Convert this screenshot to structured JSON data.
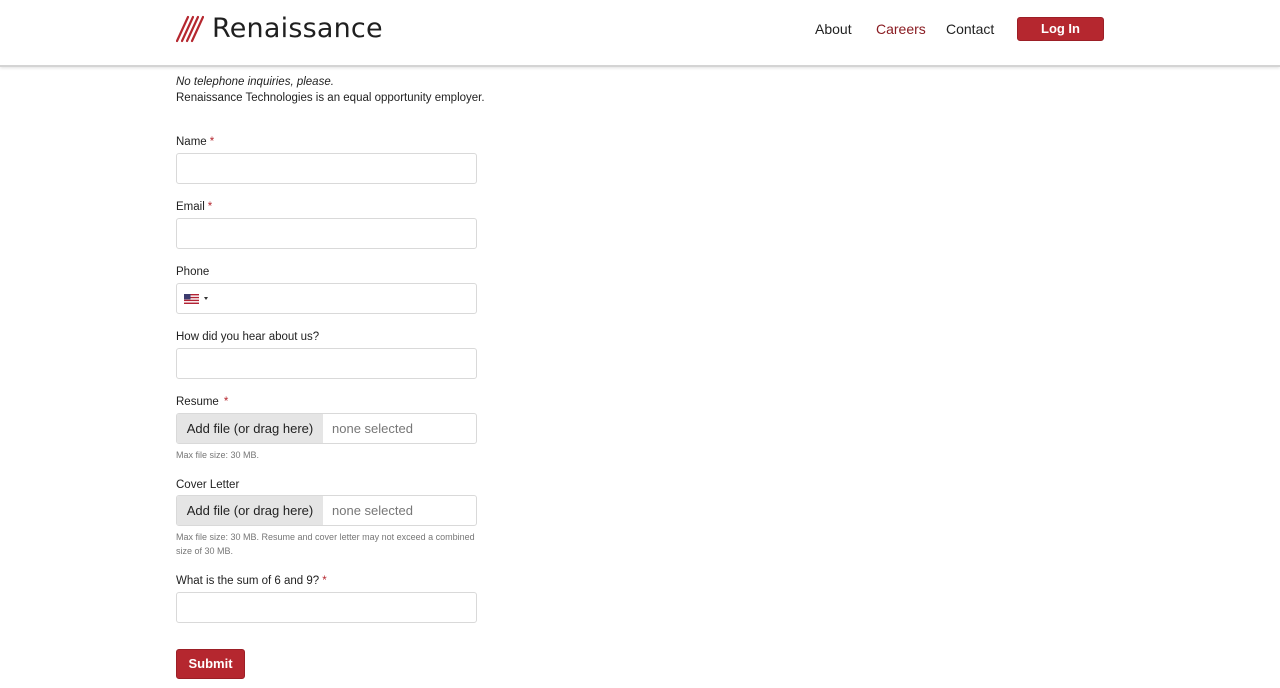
{
  "brand": {
    "name": "Renaissance",
    "accent_color": "#b5272f"
  },
  "nav": {
    "about": "About",
    "careers": "Careers",
    "contact": "Contact",
    "login": "Log In"
  },
  "intro": {
    "no_phone": "No telephone inquiries, please.",
    "equal_opportunity": "Renaissance Technologies is an equal opportunity employer."
  },
  "form": {
    "required_mark": "*",
    "name_label": "Name",
    "email_label": "Email",
    "phone_label": "Phone",
    "phone_country_icon": "us-flag-icon",
    "referral_label": "How did you hear about us?",
    "resume_label": "Resume",
    "resume_button": "Add file (or drag here)",
    "resume_status": "none selected",
    "resume_hint": "Max file size: 30 MB.",
    "cover_label": "Cover Letter",
    "cover_button": "Add file (or drag here)",
    "cover_status": "none selected",
    "cover_hint": "Max file size: 30 MB. Resume and cover letter may not exceed a combined size of 30 MB.",
    "captcha_label": "What is the sum of 6 and 9?",
    "submit": "Submit"
  }
}
